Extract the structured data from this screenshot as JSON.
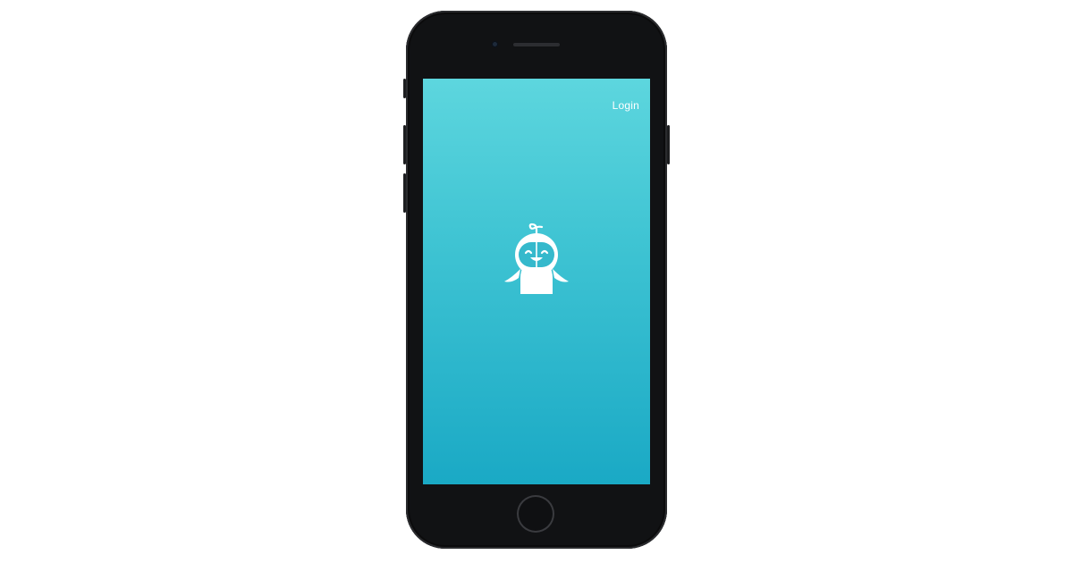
{
  "app": {
    "login_label": "Login",
    "mascot_icon": "robot-mascot-icon"
  },
  "colors": {
    "gradient_top": "#5dd6de",
    "gradient_bottom": "#1aa9c5",
    "phone_body": "#111214",
    "text": "#ffffff"
  }
}
